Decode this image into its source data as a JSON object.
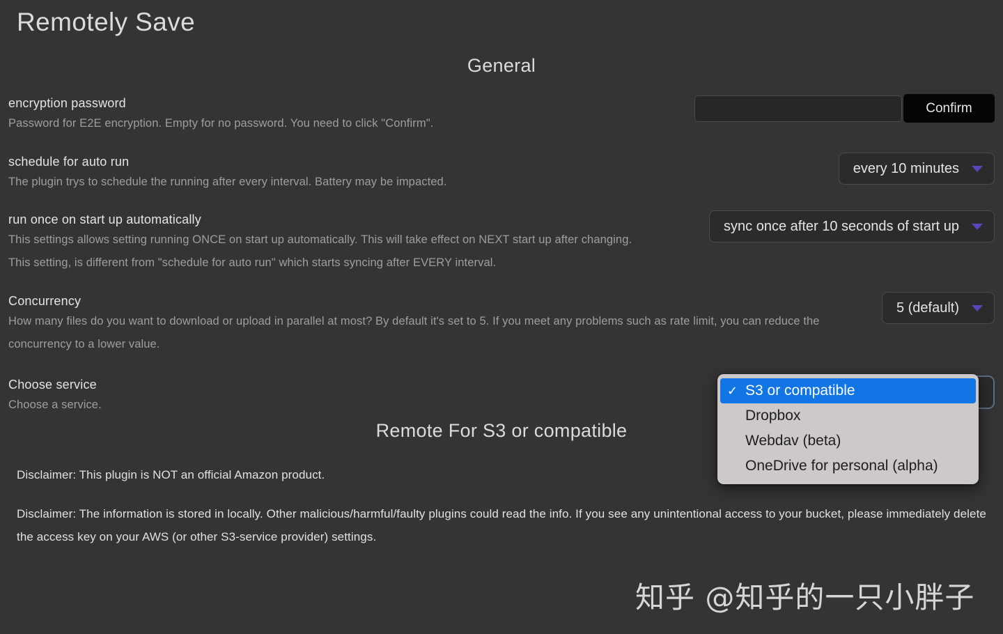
{
  "app": {
    "title": "Remotely Save"
  },
  "sections": {
    "general_heading": "General",
    "remote_heading": "Remote For S3 or compatible"
  },
  "settings": {
    "encryption": {
      "name": "encryption password",
      "desc": "Password for E2E encryption. Empty for no password. You need to click \"Confirm\".",
      "input_value": "",
      "input_placeholder": "",
      "confirm_label": "Confirm"
    },
    "schedule": {
      "name": "schedule for auto run",
      "desc": "The plugin trys to schedule the running after every interval. Battery may be impacted.",
      "selected": "every 10 minutes",
      "caret_icon": "chevron-down-icon"
    },
    "startup": {
      "name": "run once on start up automatically",
      "desc": "This settings allows setting running ONCE on start up automatically. This will take effect on NEXT start up after changing. This setting, is different from \"schedule for auto run\" which starts syncing after EVERY interval.",
      "selected": "sync once after 10 seconds of start up",
      "caret_icon": "chevron-down-icon"
    },
    "concurrency": {
      "name": "Concurrency",
      "desc": "How many files do you want to download or upload in parallel at most? By default it's set to 5. If you meet any problems such as rate limit, you can reduce the concurrency to a lower value.",
      "selected": "5 (default)",
      "caret_icon": "chevron-down-icon"
    },
    "service": {
      "name": "Choose service",
      "desc": "Choose a service.",
      "selected": "S3 or compatible",
      "options": [
        {
          "label": "S3 or compatible",
          "selected": true
        },
        {
          "label": "Dropbox",
          "selected": false
        },
        {
          "label": "Webdav (beta)",
          "selected": false
        },
        {
          "label": "OneDrive for personal (alpha)",
          "selected": false
        }
      ],
      "check_glyph": "✓"
    }
  },
  "disclaimers": {
    "first": "Disclaimer: This plugin is NOT an official Amazon product.",
    "second": "Disclaimer: The information is stored in locally. Other malicious/harmful/faulty plugins could read the info. If you see any unintentional access to your bucket, please immediately delete the access key on your AWS (or other S3-service provider) settings."
  },
  "watermark": {
    "text": "知乎 @知乎的一只小胖子"
  },
  "colors": {
    "background": "#343434",
    "accent_caret": "#5647bd",
    "highlight_blue": "#1175e6",
    "popup_bg": "#cdc9cb",
    "confirm_bg": "#050505"
  }
}
